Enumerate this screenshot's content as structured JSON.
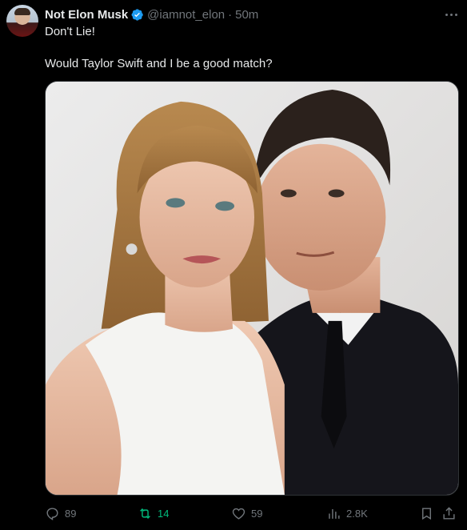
{
  "tweet": {
    "author": {
      "display_name": "Not Elon Musk",
      "handle": "@iamnot_elon",
      "separator": "·",
      "time": "50m",
      "verified": true,
      "avatar_icon": "avatar-image"
    },
    "text": {
      "line1": "Don't Lie!",
      "line2": "Would Taylor Swift and I be a good match?"
    },
    "media": {
      "type": "photo"
    },
    "actions": {
      "replies": "89",
      "retweets": "14",
      "likes": "59",
      "views": "2.8K"
    },
    "icons": [
      "reply-icon",
      "retweet-icon",
      "like-icon",
      "views-icon",
      "bookmark-icon",
      "share-icon",
      "more-icon",
      "verified-badge-icon"
    ],
    "colors": {
      "background": "#000000",
      "text": "#e7e9ea",
      "muted": "#71767b",
      "verified": "#1d9bf0",
      "retweet_active": "#00ba7c"
    }
  }
}
